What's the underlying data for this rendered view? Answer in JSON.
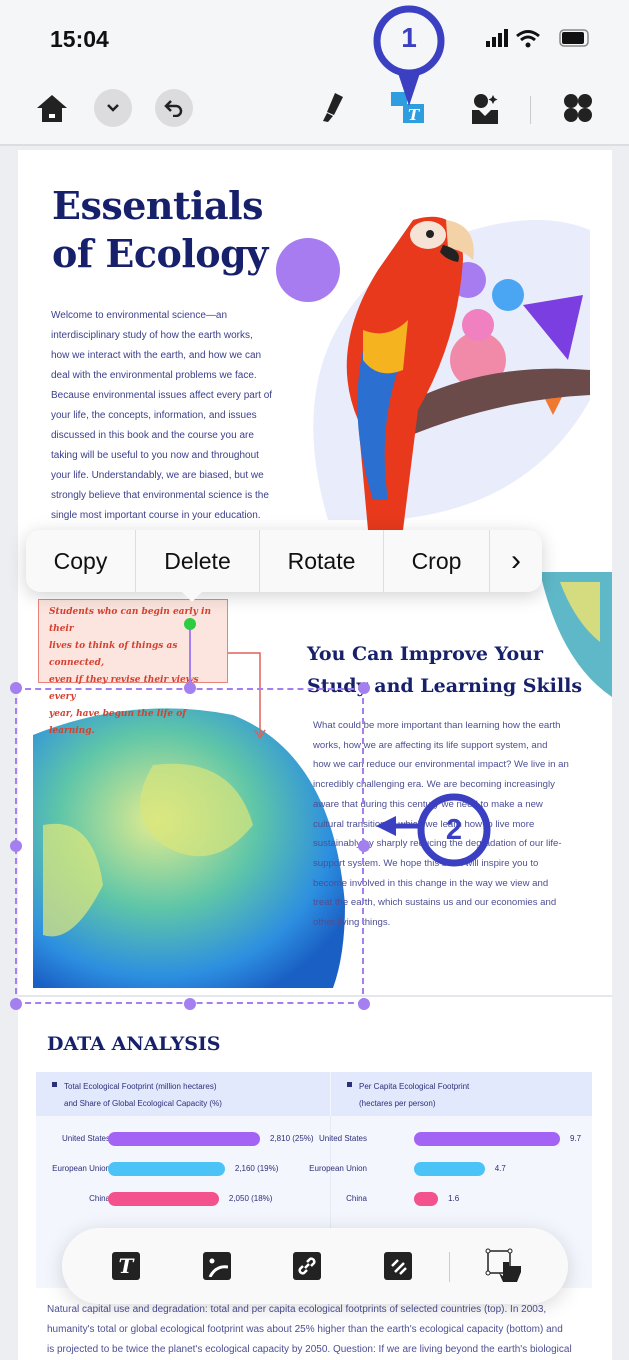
{
  "status": {
    "time": "15:04"
  },
  "toolbar": {
    "items": [
      "home-icon",
      "chevron-down-icon",
      "undo-icon",
      "highlighter-icon",
      "image-text-icon",
      "ai-image-icon",
      "apps-icon"
    ],
    "active": "image-text-icon",
    "accent": "#2f9ede"
  },
  "callouts": {
    "one": "1",
    "two": "2",
    "color": "#3b3fc2"
  },
  "document": {
    "title_lines": [
      "Essentials",
      "of Ecology"
    ],
    "intro_lines": [
      "Welcome to environmental science—an",
      "interdisciplinary study of how the earth works,",
      "how we interact with the earth, and how we can",
      "deal with the environmental problems we face.",
      "Because environmental issues affect every part of",
      "your life, the concepts, information, and issues",
      "discussed in this book and the course you are",
      "taking will be useful to you now and throughout",
      "your life. Understandably, we are biased, but we",
      "strongly believe that environmental science is the",
      "single most important course in your education."
    ],
    "quote_lines": [
      "Students who can begin early in their",
      "lives to think of things as connected,",
      "even if they revise their views every",
      "year, have begun the life of learning."
    ],
    "heading_lines": [
      "You Can Improve Your",
      "Study and Learning Skills"
    ],
    "para_lines": [
      "What could be more important than learning how the earth",
      "works, how we are affecting its life support system, and",
      "how we can reduce our environmental impact? We live in an",
      "incredibly challenging era. We are becoming increasingly",
      "aware that during this century we need to make a new",
      "cultural transition in which we learn how to live more",
      "sustainably by sharply reducing the degradation of our life-",
      "support system. We hope this book will inspire you to",
      "become involved in this change in the way we view and",
      "treat the earth, which sustains us and our economies and",
      "other living things."
    ],
    "data_title": "DATA ANALYSIS",
    "caption_lines": [
      "Natural capital use and degradation: total and per capita ecological footprints of selected countries (top). In 2003,",
      "humanity's total or global ecological footprint was about 25% higher than the earth's ecological capacity (bottom) and",
      "is projected to be twice the planet's ecological capacity by 2050. Question: If we are living beyond the earth's biological"
    ]
  },
  "chart_data": [
    {
      "type": "bar",
      "orientation": "horizontal",
      "title_lines": [
        "Total Ecological Footprint (million hectares)",
        "and Share of Global Ecological Capacity (%)"
      ],
      "categories": [
        "United States",
        "European Union",
        "China"
      ],
      "values": [
        2810,
        2160,
        2050
      ],
      "labels": [
        "2,810 (25%)",
        "2,160 (19%)",
        "2,050 (18%)"
      ],
      "colors": [
        "#a363f5",
        "#4cc3f7",
        "#f4528c"
      ]
    },
    {
      "type": "bar",
      "orientation": "horizontal",
      "title_lines": [
        "Per Capita Ecological Footprint",
        "(hectares per person)"
      ],
      "categories": [
        "United States",
        "European Union",
        "China"
      ],
      "values": [
        9.7,
        4.7,
        1.6
      ],
      "labels": [
        "9.7",
        "4.7",
        "1.6"
      ],
      "colors": [
        "#a363f5",
        "#4cc3f7",
        "#f4528c"
      ]
    }
  ],
  "context_menu": {
    "items": [
      "Copy",
      "Delete",
      "Rotate",
      "Crop"
    ],
    "more": "›"
  },
  "bottom_toolbar": {
    "items": [
      "text-icon",
      "image-icon",
      "link-icon",
      "stamp-icon",
      "select-area-icon"
    ]
  }
}
